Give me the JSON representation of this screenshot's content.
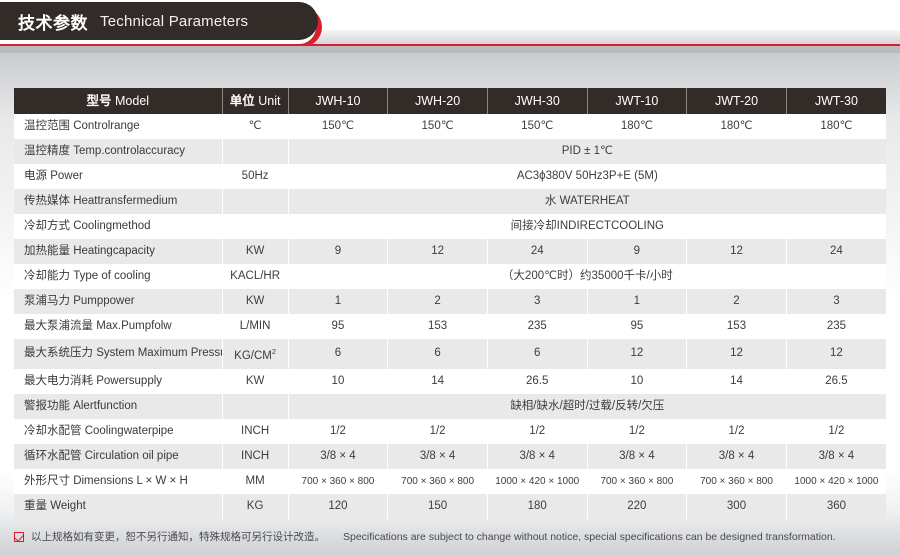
{
  "header": {
    "title_cn": "技术参数",
    "title_en": "Technical Parameters",
    "accent_color": "#d8202c",
    "pill_color": "#332b28"
  },
  "table": {
    "columns": [
      {
        "cn": "型号",
        "en": "Model",
        "name": "model"
      },
      {
        "cn": "单位",
        "en": "Unit",
        "name": "unit"
      },
      {
        "cn": "",
        "en": "JWH-10",
        "name": "jwh-10"
      },
      {
        "cn": "",
        "en": "JWH-20",
        "name": "jwh-20"
      },
      {
        "cn": "",
        "en": "JWH-30",
        "name": "jwh-30"
      },
      {
        "cn": "",
        "en": "JWT-10",
        "name": "jwt-10"
      },
      {
        "cn": "",
        "en": "JWT-20",
        "name": "jwt-20"
      },
      {
        "cn": "",
        "en": "JWT-30",
        "name": "jwt-30"
      }
    ],
    "rows": [
      {
        "label_cn": "温控范围",
        "label_en": "Controlrange",
        "unit": "℃",
        "values": [
          "150℃",
          "150℃",
          "150℃",
          "180℃",
          "180℃",
          "180℃"
        ]
      },
      {
        "label_cn": "温控精度",
        "label_en": "Temp.controlaccuracy",
        "unit": "",
        "merged": "PID ± 1℃"
      },
      {
        "label_cn": "电源",
        "label_en": "Power",
        "unit": "50Hz",
        "merged": "AC3ϕ380V 50Hz3P+E (5M)"
      },
      {
        "label_cn": "传热媒体",
        "label_en": "Heattransfermedium",
        "unit": "",
        "merged": "水 WATERHEAT"
      },
      {
        "label_cn": "冷却方式",
        "label_en": "Coolingmethod",
        "unit": "",
        "merged": "间接冷却INDIRECTCOOLING"
      },
      {
        "label_cn": "加热能量",
        "label_en": "Heatingcapacity",
        "unit": "KW",
        "values": [
          "9",
          "12",
          "24",
          "9",
          "12",
          "24"
        ]
      },
      {
        "label_cn": "冷却能力",
        "label_en": "Type of cooling",
        "unit": "KACL/HR",
        "merged": "（大200℃时）约35000千卡/小时"
      },
      {
        "label_cn": "泵浦马力",
        "label_en": "Pumppower",
        "unit": "KW",
        "values": [
          "1",
          "2",
          "3",
          "1",
          "2",
          "3"
        ]
      },
      {
        "label_cn": "最大泵浦流量",
        "label_en": "Max.Pumpfolw",
        "unit": "L/MIN",
        "values": [
          "95",
          "153",
          "235",
          "95",
          "153",
          "235"
        ]
      },
      {
        "label_cn": "最大系统压力",
        "label_en": "System Maximum Pressure",
        "unit": "KG/CM2",
        "unit_sup": "2",
        "unit_base": "KG/CM",
        "values": [
          "6",
          "6",
          "6",
          "12",
          "12",
          "12"
        ]
      },
      {
        "label_cn": "最大电力消耗",
        "label_en": "Powersupply",
        "unit": "KW",
        "values": [
          "10",
          "14",
          "26.5",
          "10",
          "14",
          "26.5"
        ]
      },
      {
        "label_cn": "警报功能",
        "label_en": "Alertfunction",
        "unit": "",
        "merged": "缺相/缺水/超时/过载/反转/欠压"
      },
      {
        "label_cn": "冷却水配管",
        "label_en": "Coolingwaterpipe",
        "unit": "INCH",
        "values": [
          "1/2",
          "1/2",
          "1/2",
          "1/2",
          "1/2",
          "1/2"
        ]
      },
      {
        "label_cn": "循环水配管",
        "label_en": "Circulation oil pipe",
        "unit": "INCH",
        "values": [
          "3/8 × 4",
          "3/8 × 4",
          "3/8 × 4",
          "3/8 × 4",
          "3/8 × 4",
          "3/8 × 4"
        ]
      },
      {
        "label_cn": "外形尺寸",
        "label_en": "Dimensions L × W × H",
        "unit": "MM",
        "small": true,
        "values": [
          "700 × 360 × 800",
          "700 × 360 × 800",
          "1000 × 420 × 1000",
          "700 × 360 × 800",
          "700 × 360 × 800",
          "1000 × 420 × 1000"
        ]
      },
      {
        "label_cn": "重量",
        "label_en": "Weight",
        "unit": "KG",
        "values": [
          "120",
          "150",
          "180",
          "220",
          "300",
          "360"
        ]
      }
    ]
  },
  "footnote": {
    "icon": "checkbox-checked-icon",
    "cn": "以上规格如有变更，恕不另行通知，特殊规格可另行设计改造。",
    "en": "Specifications are subject to change without notice, special specifications can be designed transformation."
  }
}
